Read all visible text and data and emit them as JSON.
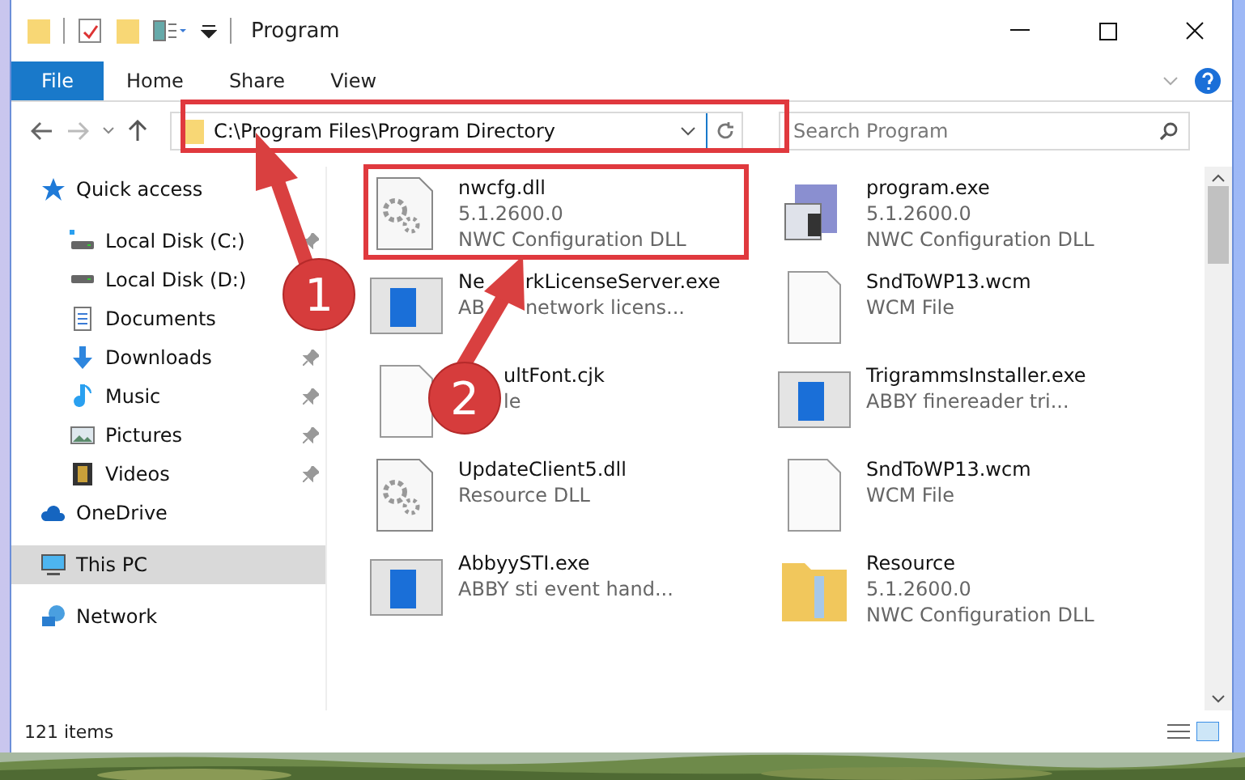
{
  "window": {
    "title": "Program"
  },
  "ribbon_tabs": [
    {
      "label": "File",
      "selected": true
    },
    {
      "label": "Home",
      "selected": false
    },
    {
      "label": "Share",
      "selected": false
    },
    {
      "label": "View",
      "selected": false
    }
  ],
  "address": {
    "path": "C:\\Program Files\\Program Directory"
  },
  "search": {
    "placeholder": "Search Program"
  },
  "sidebar": [
    {
      "label": "Quick access",
      "kind": "star",
      "selected": false,
      "children": [
        {
          "label": "Local Disk (C:)",
          "kind": "diskc",
          "pinned": true,
          "selected": false
        },
        {
          "label": "Local Disk (D:)",
          "kind": "disk",
          "pinned": false,
          "selected": false
        },
        {
          "label": "Documents",
          "kind": "doc",
          "pinned": false,
          "selected": false
        },
        {
          "label": "Downloads",
          "kind": "down",
          "pinned": true,
          "selected": false
        },
        {
          "label": "Music",
          "kind": "music",
          "pinned": true,
          "selected": false
        },
        {
          "label": "Pictures",
          "kind": "pics",
          "pinned": true,
          "selected": false
        },
        {
          "label": "Videos",
          "kind": "video",
          "pinned": true,
          "selected": false
        }
      ]
    },
    {
      "label": "OneDrive",
      "kind": "cloud",
      "selected": false
    },
    {
      "label": "This PC",
      "kind": "pc",
      "selected": true
    },
    {
      "label": "Network",
      "kind": "net",
      "selected": false
    }
  ],
  "files": [
    {
      "name": "nwcfg.dll",
      "lines": [
        "5.1.2600.0",
        "NWC Configuration DLL"
      ],
      "kind": "dll"
    },
    {
      "name": "program.exe",
      "lines": [
        "5.1.2600.0",
        "NWC Configuration DLL"
      ],
      "kind": "setup"
    },
    {
      "name": [
        "Ne",
        "rkLicenseServer.exe"
      ],
      "lines": [
        [
          "AB",
          "network licens..."
        ]
      ],
      "kind": "app"
    },
    {
      "name": "SndToWP13.wcm",
      "lines": [
        "WCM File"
      ],
      "kind": "blank"
    },
    {
      "name": "ultFont.cjk",
      "lines": [
        "le"
      ],
      "kind": "blank",
      "start_covered": true
    },
    {
      "name": "TrigrammsInstaller.exe",
      "lines": [
        "ABBY finereader tri..."
      ],
      "kind": "app"
    },
    {
      "name": "UpdateClient5.dll",
      "lines": [
        "Resource DLL"
      ],
      "kind": "dll"
    },
    {
      "name": "SndToWP13.wcm",
      "lines": [
        "WCM File"
      ],
      "kind": "blank"
    },
    {
      "name": "AbbyySTI.exe",
      "lines": [
        "ABBY sti event hand..."
      ],
      "kind": "app"
    },
    {
      "name": "Resource",
      "lines": [
        "5.1.2600.0",
        "NWC Configuration DLL"
      ],
      "kind": "folder"
    }
  ],
  "status_bar": {
    "count": "121 items"
  },
  "callouts": [
    {
      "number": "1"
    },
    {
      "number": "2"
    }
  ]
}
